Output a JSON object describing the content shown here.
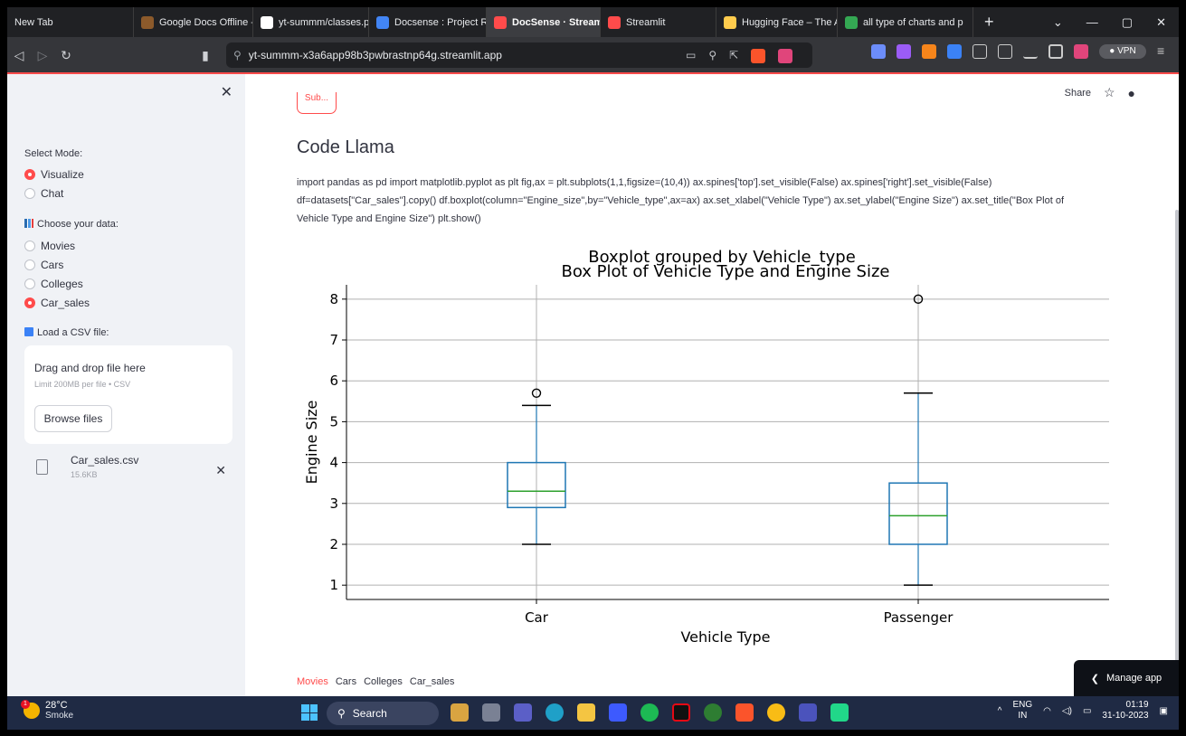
{
  "browser": {
    "tabs": [
      {
        "title": "New Tab",
        "icon": "none",
        "color": ""
      },
      {
        "title": "Google Docs Offline - C",
        "icon": "docs-offline-icon",
        "color": "#8c5a2b"
      },
      {
        "title": "yt-summm/classes.py a",
        "icon": "github-icon",
        "color": "#ffffff"
      },
      {
        "title": "Docsense : Project Rep",
        "icon": "google-docs-icon",
        "color": "#4285f4"
      },
      {
        "title": "DocSense · Stream",
        "icon": "streamlit-icon",
        "color": "#ff4b4b"
      },
      {
        "title": "Streamlit",
        "icon": "streamlit-icon",
        "color": "#ff4b4b"
      },
      {
        "title": "Hugging Face – The AI",
        "icon": "hugging-face-icon",
        "color": "#ffcc4d"
      },
      {
        "title": "all type of charts and p",
        "icon": "google-icon",
        "color": "#34a853"
      }
    ],
    "active_tab_close": "×",
    "new_tab": "+",
    "url": "yt-summm-x3a6app98b3pwbrastnp64g.streamlit.app",
    "vpn_label": "● VPN"
  },
  "sidebar": {
    "mode_label": "Select Mode:",
    "modes": [
      {
        "label": "Visualize",
        "selected": true
      },
      {
        "label": "Chat",
        "selected": false
      }
    ],
    "data_label": "Choose your data:",
    "datasets": [
      {
        "label": "Movies",
        "selected": false
      },
      {
        "label": "Cars",
        "selected": false
      },
      {
        "label": "Colleges",
        "selected": false
      },
      {
        "label": "Car_sales",
        "selected": true
      }
    ],
    "csv_label": "Load a CSV file:",
    "uploader": {
      "title": "Drag and drop file here",
      "limit": "Limit 200MB per file • CSV",
      "button": "Browse files"
    },
    "file": {
      "name": "Car_sales.csv",
      "size": "15.6KB"
    }
  },
  "main": {
    "share": "Share",
    "cut_button": "Sub...",
    "heading": "Code Llama",
    "code_lines": [
      "import pandas as pd import matplotlib.pyplot as plt fig,ax = plt.subplots(1,1,figsize=(10,4)) ax.spines['top'].set_visible(False) ax.spines['right'].set_visible(False)",
      "df=datasets[\"Car_sales\"].copy() df.boxplot(column=\"Engine_size\",by=\"Vehicle_type\",ax=ax) ax.set_xlabel(\"Vehicle Type\") ax.set_ylabel(\"Engine Size\") ax.set_title(\"Box Plot of",
      "Vehicle Type and Engine Size\") plt.show()"
    ],
    "bottom_links": [
      "Movies",
      "Cars",
      "Colleges",
      "Car_sales"
    ],
    "manage_app": "Manage app"
  },
  "chart_data": {
    "type": "box",
    "suptitle": "Boxplot grouped by Vehicle_type",
    "title": "Box Plot of Vehicle Type and Engine Size",
    "xlabel": "Vehicle Type",
    "ylabel": "Engine Size",
    "categories": [
      "Car",
      "Passenger"
    ],
    "boxes": [
      {
        "category": "Car",
        "whisker_low": 2.0,
        "q1": 2.9,
        "median": 3.3,
        "q3": 4.0,
        "whisker_high": 5.4,
        "outliers": [
          5.7
        ]
      },
      {
        "category": "Passenger",
        "whisker_low": 1.0,
        "q1": 2.0,
        "median": 2.7,
        "q3": 3.5,
        "whisker_high": 5.7,
        "outliers": [
          8.0
        ]
      }
    ],
    "yticks": [
      1,
      2,
      3,
      4,
      5,
      6,
      7,
      8
    ],
    "ylim": [
      0.65,
      8.35
    ],
    "grid": true,
    "colors": {
      "box": "#1f77b4",
      "median": "#2ca02c",
      "whisker": "#1f77b4",
      "cap": "#000000"
    }
  },
  "taskbar": {
    "temp": "28°C",
    "weather": "Smoke",
    "weather_badge": "1",
    "search": "Search",
    "lang_1": "ENG",
    "lang_2": "IN",
    "time": "01:19",
    "date": "31-10-2023"
  }
}
